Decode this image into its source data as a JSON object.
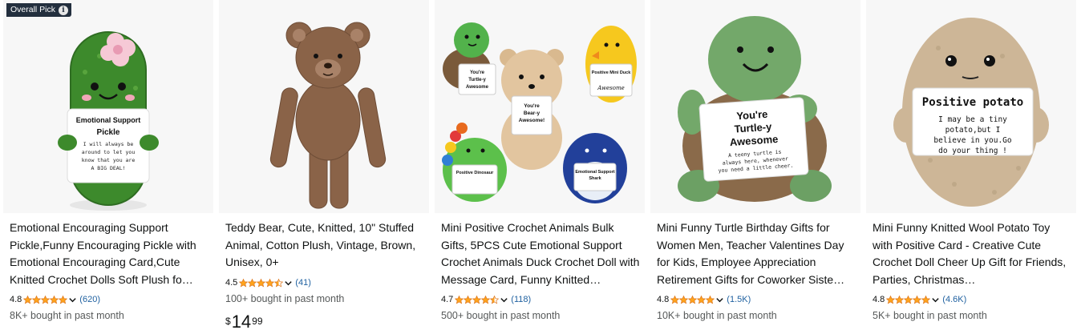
{
  "badge": {
    "label": "Overall Pick",
    "info_glyph": "i"
  },
  "colors": {
    "star": "#ffa41c",
    "link": "#2162a1",
    "secondary_text": "#565959",
    "badge_bg": "#232f3e"
  },
  "products": [
    {
      "title": "Emotional Encouraging Support Pickle,Funny Encouraging Pickle with Emotional Encouraging Card,Cute Knitted Crochet Dolls Soft Plush fo…",
      "rating": "4.8",
      "rating_value": 4.8,
      "review_count": "(620)",
      "bought": "8K+ bought in past month",
      "image_label": "pickle-plush",
      "card_text": {
        "heading": "Emotional Support Pickle",
        "body": "I will always be around to let you know that you are A BIG DEAL!"
      }
    },
    {
      "title": "Teddy Bear, Cute, Knitted, 10\" Stuffed Animal, Cotton Plush, Vintage, Brown, Unisex, 0+",
      "rating": "4.5",
      "rating_value": 4.5,
      "review_count": "(41)",
      "bought": "100+ bought in past month",
      "price": {
        "symbol": "$",
        "whole": "14",
        "fraction": "99"
      },
      "image_label": "teddy-bear"
    },
    {
      "title": "Mini Positive Crochet Animals Bulk Gifts, 5PCS Cute Emotional Support Crochet Animals Duck Crochet Doll with Message Card, Funny Knitted…",
      "rating": "4.7",
      "rating_value": 4.7,
      "review_count": "(118)",
      "bought": "500+ bought in past month",
      "image_label": "crochet-animal-set",
      "card_text": {
        "turtle": "You're Turtle-y Awesome",
        "bear": "You're Bear-y Awesome!",
        "duck": "Positive Mini Duck",
        "dino": "Positive Dinosaur",
        "shark": "Emotional Support Shark"
      }
    },
    {
      "title": "Mini Funny Turtle Birthday Gifts for Women Men, Teacher Valentines Day for Kids, Employee Appreciation Retirement Gifts for Coworker Siste…",
      "rating": "4.8",
      "rating_value": 4.8,
      "review_count": "(1.5K)",
      "bought": "10K+ bought in past month",
      "image_label": "turtle-plush",
      "card_text": {
        "heading": "You're Turtle-y Awesome",
        "body": "A teeny turtle is always here, whenever you need a little cheer."
      }
    },
    {
      "title": "Mini Funny Knitted Wool Potato Toy with Positive Card - Creative Cute Crochet Doll Cheer Up Gift for Friends, Parties, Christmas…",
      "rating": "4.8",
      "rating_value": 4.8,
      "review_count": "(4.6K)",
      "bought": "5K+ bought in past month",
      "image_label": "potato-plush",
      "card_text": {
        "heading": "Positive potato",
        "body": "I may be a tiny potato,but I believe in you.Go do your thing !"
      }
    }
  ]
}
